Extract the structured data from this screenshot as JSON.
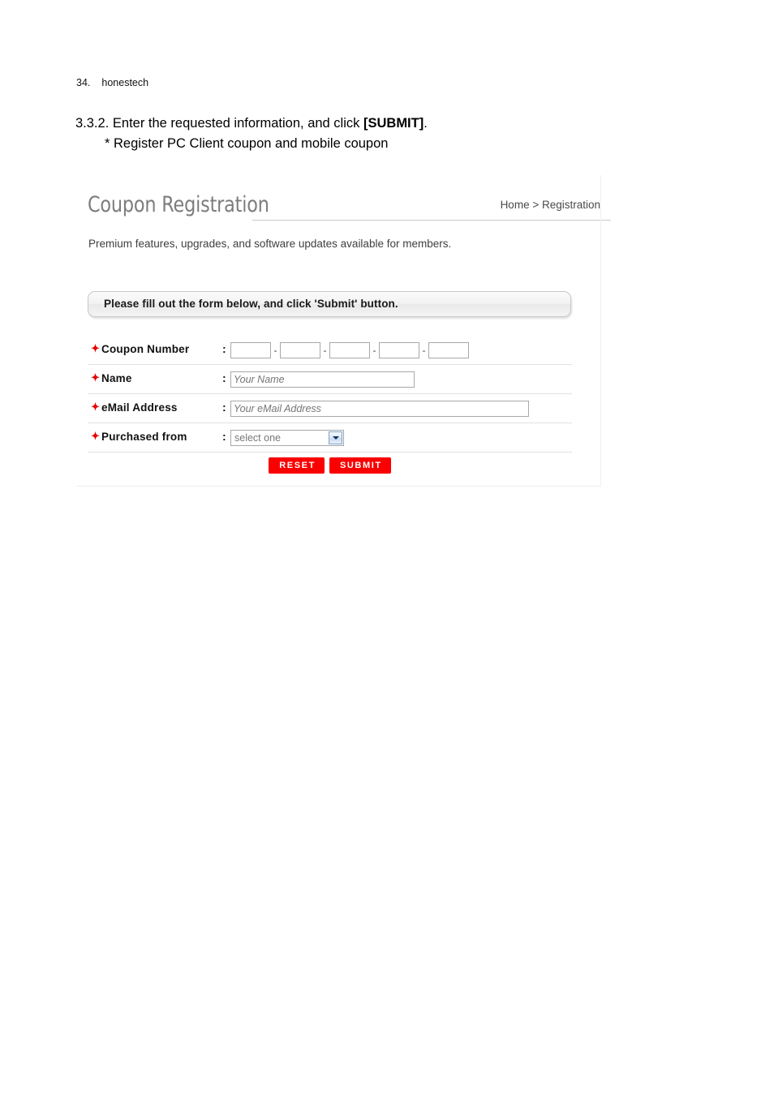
{
  "page_header": {
    "number": "34.",
    "brand": "honestech"
  },
  "instructions": {
    "step_number": "3.3.2.",
    "step_text_before": "Enter the requested information, and click ",
    "step_emphasis": "[SUBMIT]",
    "step_text_after": ".",
    "sub_note": "* Register PC Client coupon and mobile coupon"
  },
  "screenshot": {
    "title": "Coupon Registration",
    "breadcrumb": "Home > Registration",
    "tagline": "Premium features, upgrades, and software updates available for members.",
    "notice": "Please fill out the form below, and click 'Submit' button.",
    "required_marker": "✦",
    "colon": ":",
    "separator": "-",
    "form_rows": [
      {
        "label": "Coupon Number",
        "type": "coupon-segments",
        "segments": [
          "",
          "",
          "",
          "",
          ""
        ],
        "segment_count": 5
      },
      {
        "label": "Name",
        "type": "text",
        "value": "",
        "placeholder": "Your Name"
      },
      {
        "label": "eMail Address",
        "type": "text",
        "value": "",
        "placeholder": "Your eMail Address"
      },
      {
        "label": "Purchased from",
        "type": "select",
        "selected": "select one"
      }
    ],
    "buttons": {
      "reset": "RESET",
      "submit": "SUBMIT"
    },
    "colors": {
      "required": "#e60000",
      "button": "#fa0000",
      "title": "#7d7d7d"
    }
  }
}
